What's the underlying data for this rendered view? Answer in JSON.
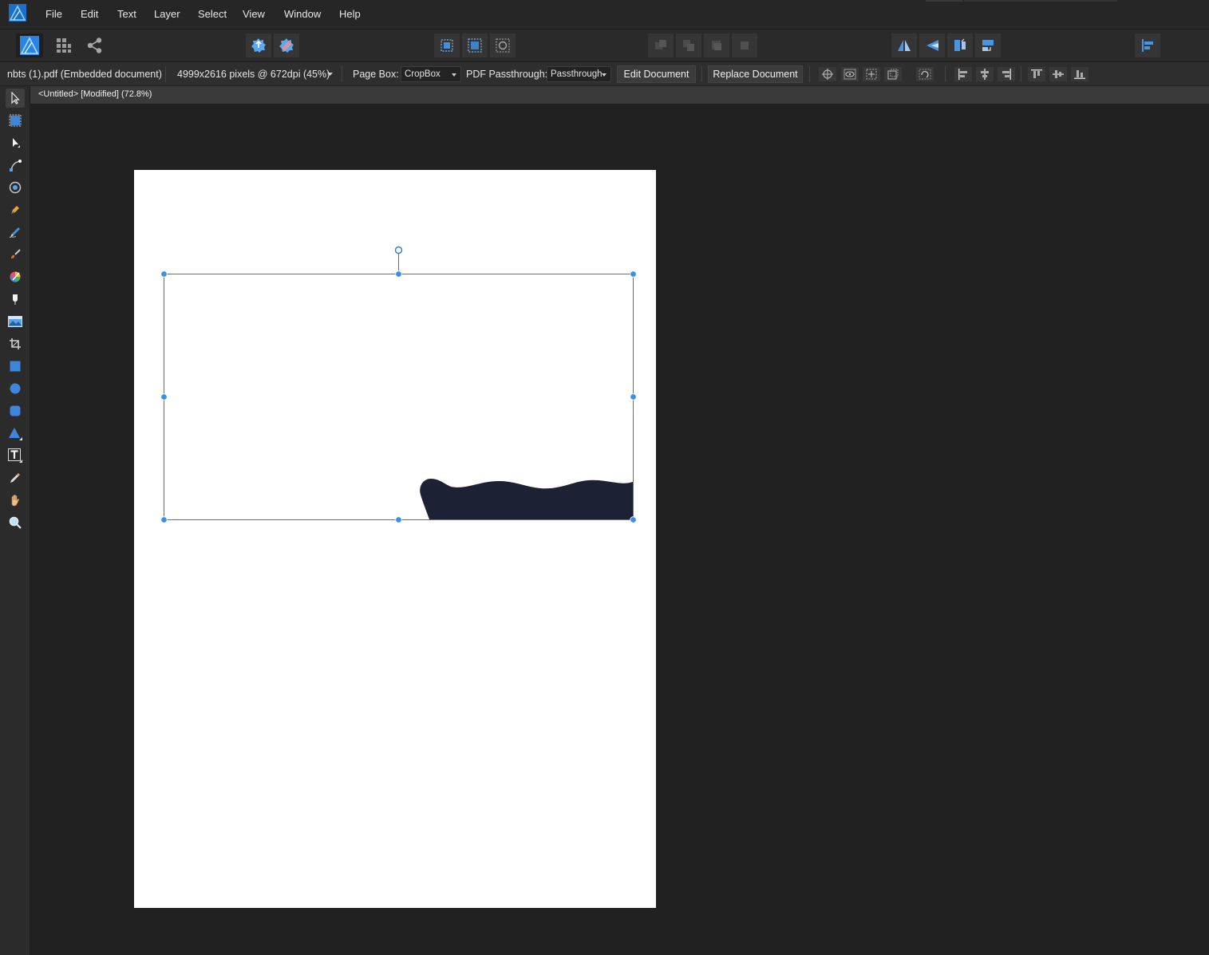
{
  "menu": {
    "items": [
      "File",
      "Edit",
      "Text",
      "Layer",
      "Select",
      "View",
      "Window",
      "Help"
    ]
  },
  "toolbar": {
    "personas": [
      "designer-persona-icon",
      "pixel-persona-icon",
      "export-persona-icon"
    ],
    "buttons": [
      "assistant-icon",
      "snapping-icon",
      "insert-behind-icon",
      "insert-front-icon",
      "insert-inside-icon",
      "move-back-icon",
      "move-backward-icon",
      "move-forward-icon",
      "move-front-icon",
      "flip-horizontal-icon",
      "flip-vertical-icon",
      "rotate-left-icon",
      "rotate-right-icon",
      "align-icon"
    ]
  },
  "context": {
    "file_label": "nbts (1).pdf (Embedded document)",
    "dimensions": "4999x2616 pixels @ 672dpi (45%)",
    "page_box_label": "Page Box:",
    "page_box_value": "CropBox",
    "pdf_passthrough_label": "PDF Passthrough:",
    "pdf_passthrough_value": "Passthrough",
    "edit_document": "Edit Document",
    "replace_document": "Replace Document"
  },
  "document": {
    "tab_title": "<Untitled> [Modified] (72.8%)"
  },
  "tools": [
    "move-tool-icon",
    "artboard-tool-icon",
    "node-tool-icon",
    "point-transform-tool-icon",
    "corner-tool-icon",
    "pen-tool-icon",
    "pencil-tool-icon",
    "vector-brush-tool-icon",
    "fill-tool-icon",
    "transparency-tool-icon",
    "place-image-tool-icon",
    "crop-tool-icon",
    "rectangle-tool-icon",
    "ellipse-tool-icon",
    "rounded-rectangle-tool-icon",
    "triangle-tool-icon",
    "artistic-text-tool-icon",
    "color-picker-tool-icon",
    "view-tool-icon",
    "zoom-tool-icon"
  ],
  "colors": {
    "accent": "#3d8ee6",
    "selection": "#2f7ad6",
    "shape_fill": "#1c2133",
    "page": "#ffffff",
    "canvas": "#212121"
  }
}
